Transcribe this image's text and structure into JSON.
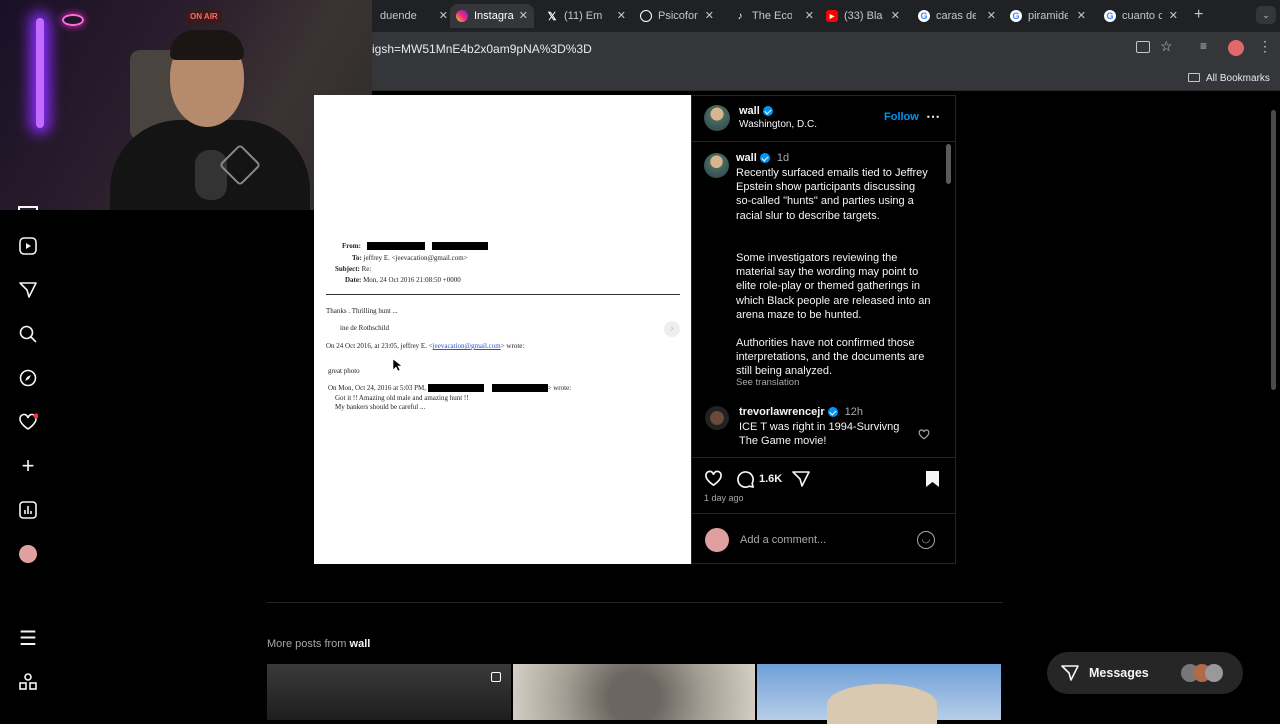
{
  "browser": {
    "tabs": [
      {
        "label": "duende",
        "icon": "google-docs-icon",
        "color": "#c4c7c5"
      },
      {
        "label": "Instagra",
        "icon": "instagram-icon",
        "color": "#e1306c"
      },
      {
        "label": "(11) Em",
        "icon": "x-icon",
        "color": "#ffffff"
      },
      {
        "label": "Psicofor",
        "icon": "openai-icon",
        "color": "#ffffff"
      },
      {
        "label": "The Eco",
        "icon": "tiktok-icon",
        "color": "#ffffff"
      },
      {
        "label": "(33) Bla",
        "icon": "youtube-icon",
        "color": "#ff0000"
      },
      {
        "label": "caras de",
        "icon": "google-icon",
        "color": "#4285f4"
      },
      {
        "label": "piramide",
        "icon": "google-icon",
        "color": "#4285f4"
      },
      {
        "label": "cuanto c",
        "icon": "google-icon",
        "color": "#4285f4"
      }
    ],
    "url": "igsh=MW51MnE4b2x0am9pNA%3D%3D",
    "bookmarks_label": "All Bookmarks"
  },
  "webcam": {
    "sign": "ON AIR"
  },
  "document": {
    "from_label": "From:",
    "to_label": "To:",
    "to_value": "jeffrey E. <jeevacation@gmail.com>",
    "subject_label": "Subject:",
    "subject_value": "Re:",
    "date_label": "Date:",
    "date_value": "Mon, 24 Oct 2016 21:08:50 +0000",
    "line1": "Thanks . Thrilling hunt ...",
    "line2": "ine de Rothschild",
    "quote_prefix": "On 24 Oct 2016, at 23:05, jeffrey E. <",
    "quote_email": "jeevacation@gmail.com",
    "quote_suffix": "> wrote:",
    "line3": "great photo",
    "quote2_prefix": "On Mon, Oct 24, 2016 at 5:03 PM,",
    "quote2_suffix": "> wrote:",
    "line4": "Got it !! Amazing old male and amazing hunt !!",
    "line5": "My bankers should be careful ..."
  },
  "post": {
    "username": "wall",
    "location": "Washington, D.C.",
    "follow_label": "Follow",
    "caption_time": "1d",
    "caption_p1": "Recently surfaced emails tied to Jeffrey Epstein show participants discussing so-called \"hunts\" and parties using a racial slur to describe targets.",
    "caption_p2": "Some investigators reviewing the material say the wording may point to elite role-play or themed gatherings in which Black people are released into an arena maze to be hunted.",
    "caption_p3": "Authorities have not confirmed those interpretations, and the documents are still being analyzed.",
    "see_translation": "See translation",
    "comment_user": "trevorlawrencejr",
    "comment_time": "12h",
    "comment_text": "ICE T was right in 1994-Survivng The Game movie!",
    "comment_count": "1.6K",
    "posted_ago": "1 day ago",
    "add_comment_placeholder": "Add a comment..."
  },
  "more_posts": {
    "prefix": "More posts from ",
    "user": "wall"
  },
  "messages_label": "Messages"
}
